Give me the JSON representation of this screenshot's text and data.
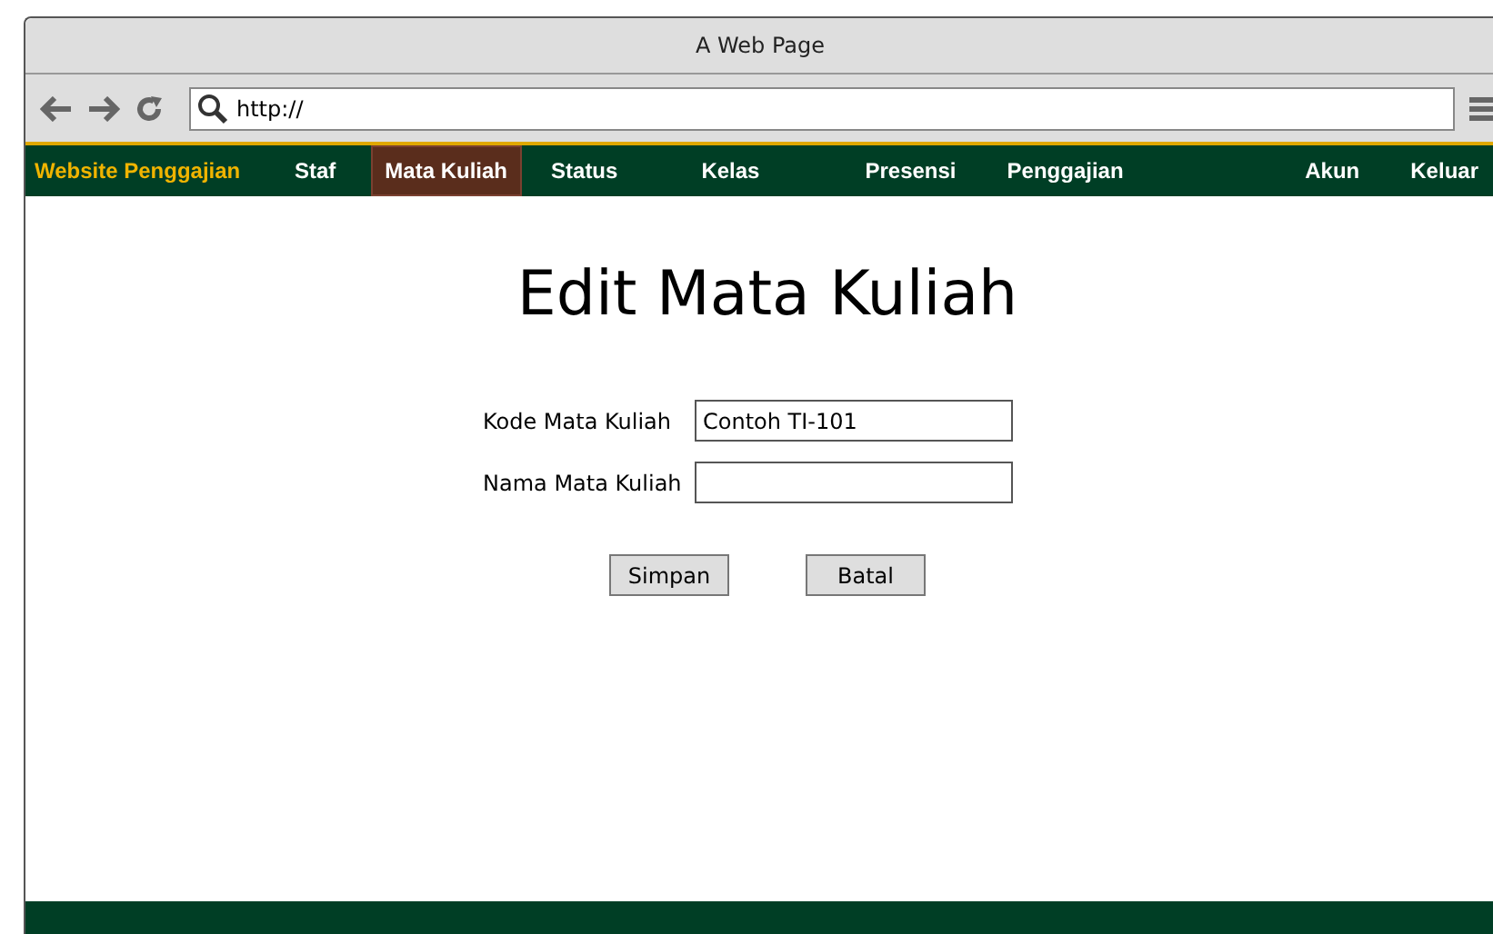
{
  "window": {
    "title": "A Web Page"
  },
  "browser": {
    "url": "http://"
  },
  "nav": {
    "brand": "Website Penggajian",
    "items": [
      {
        "label": "Staf",
        "selected": false
      },
      {
        "label": "Mata Kuliah",
        "selected": true
      },
      {
        "label": "Status",
        "selected": false
      },
      {
        "label": "Kelas",
        "selected": false
      },
      {
        "label": "Presensi",
        "selected": false
      },
      {
        "label": "Penggajian",
        "selected": false
      }
    ],
    "right_items": [
      {
        "label": "Akun",
        "selected": false
      },
      {
        "label": "Keluar",
        "selected": false
      }
    ]
  },
  "page": {
    "heading": "Edit Mata Kuliah",
    "fields": [
      {
        "label": "Kode Mata Kuliah",
        "value": "Contoh TI-101"
      },
      {
        "label": "Nama Mata Kuliah"
      }
    ],
    "buttons": [
      "Simpan",
      "Batal"
    ]
  }
}
